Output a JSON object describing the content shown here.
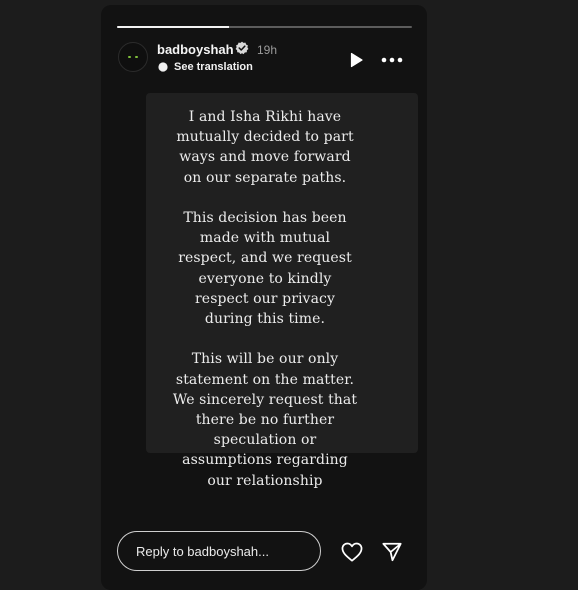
{
  "story": {
    "progress": 0.38,
    "username": "badboyshah",
    "verified": true,
    "timestamp": "19h",
    "translate_label": "See translation",
    "statement": "I and Isha Rikhi have\nmutually decided to part\nways and move forward\non our separate paths.\n\nThis decision has been\nmade with mutual\nrespect, and we request\neveryone to kindly\nrespect our privacy\nduring this time.\n\nThis will be our only\nstatement on the matter.\nWe sincerely request that\nthere be no further\nspeculation or\nassumptions regarding\nour relationship",
    "icons": {
      "verified": "verified-badge-icon",
      "translate": "translate-icon",
      "play": "play-icon",
      "more": "more-options-icon",
      "like": "heart-icon",
      "share": "send-icon"
    }
  },
  "reply": {
    "placeholder": "Reply to badboyshah..."
  },
  "colors": {
    "background": "#1c1c1c",
    "story_background": "#121212",
    "text": "#ececec"
  }
}
